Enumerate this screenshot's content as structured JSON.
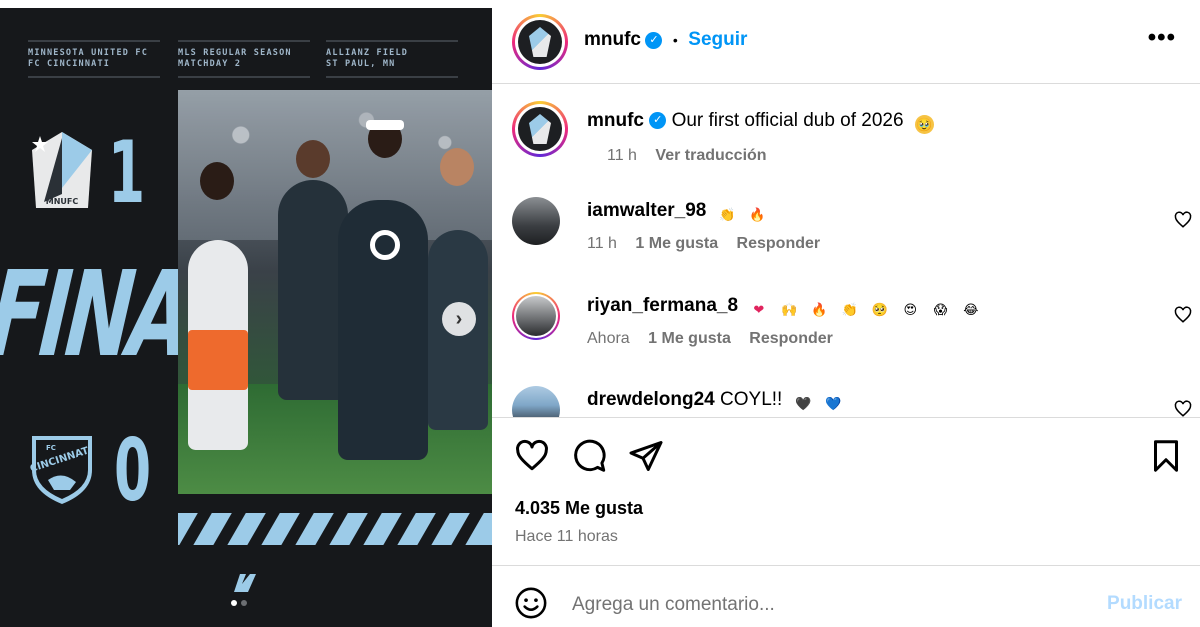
{
  "post_media": {
    "match_info": [
      {
        "line1": "MINNESOTA UNITED FC",
        "line2": "FC CINCINNATI"
      },
      {
        "line1": "MLS REGULAR SEASON",
        "line2": "MATCHDAY 2"
      },
      {
        "line1": "ALLIANZ FIELD",
        "line2": "ST PAUL, MN"
      }
    ],
    "home_score": "1",
    "away_score": "0",
    "final_label": "FINAL",
    "home_crest_label": "MNUFC",
    "away_crest_label": "FC CINCINNATI",
    "carousel_index": 1,
    "carousel_total": 2
  },
  "header": {
    "username": "mnufc",
    "follow_label": "Seguir",
    "separator": "•",
    "more_label": "•••"
  },
  "caption": {
    "username": "mnufc",
    "text": "Our first official dub of 2026",
    "time": "11 h",
    "translate_label": "Ver traducción"
  },
  "comments": [
    {
      "username": "iamwalter_98",
      "text": "",
      "emojis": [
        "👏",
        "🔥"
      ],
      "time": "11 h",
      "likes_label": "1 Me gusta",
      "reply_label": "Responder"
    },
    {
      "username": "riyan_fermana_8",
      "text": "",
      "emojis": [
        "❤",
        "🙌",
        "🔥",
        "👏",
        "🥺",
        "😍",
        "😱",
        "😂"
      ],
      "time": "Ahora",
      "likes_label": "1 Me gusta",
      "reply_label": "Responder"
    },
    {
      "username": "drewdelong24",
      "text": "COYL!!",
      "emojis": [
        "🖤",
        "💙"
      ],
      "time": "",
      "likes_label": "",
      "reply_label": ""
    }
  ],
  "stats": {
    "likes": "4.035 Me gusta",
    "posted": "Hace 11 horas"
  },
  "composer": {
    "placeholder": "Agrega un comentario...",
    "post_label": "Publicar"
  },
  "colors": {
    "accent": "#0095f6",
    "post_disabled": "#b3dbff",
    "brand_light_blue": "#9ccbe8",
    "media_bg": "#16181b"
  }
}
